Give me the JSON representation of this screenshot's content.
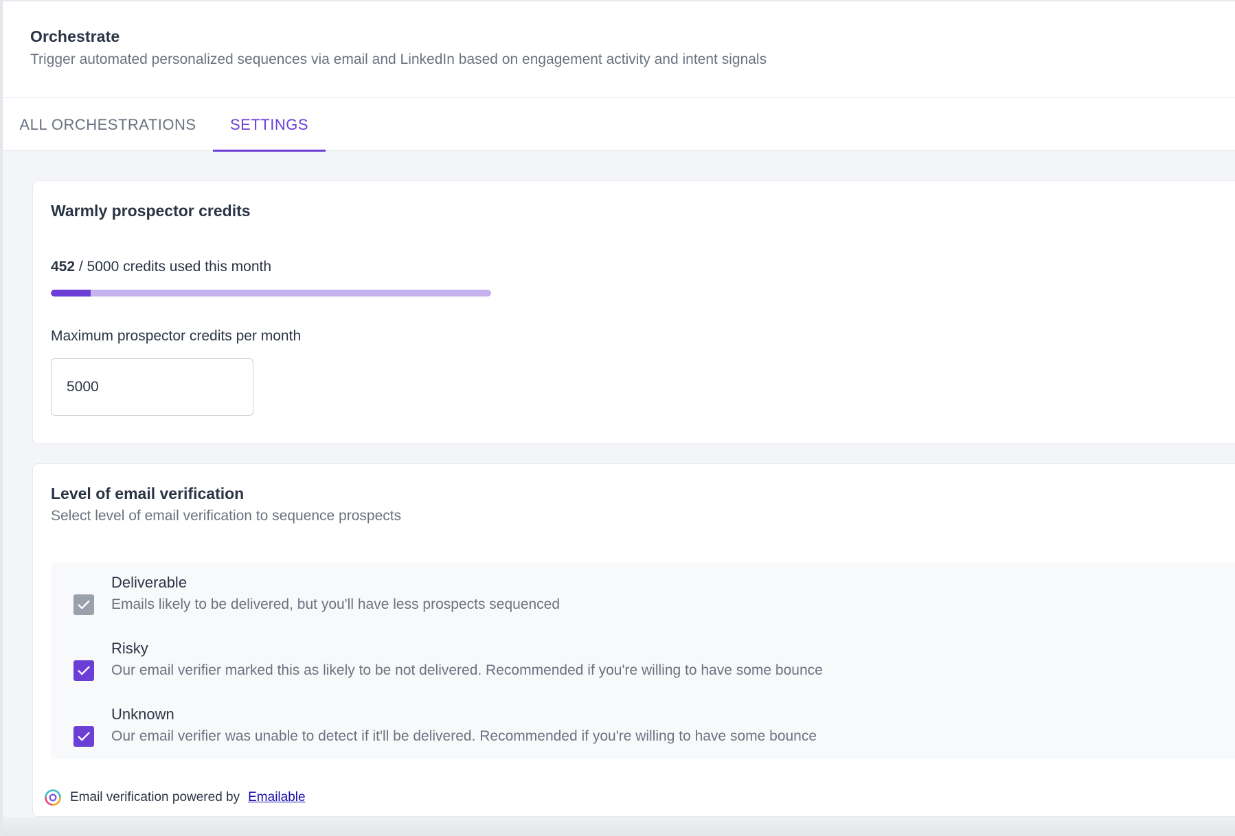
{
  "header": {
    "title": "Orchestrate",
    "subtitle": "Trigger automated personalized sequences via email and LinkedIn based on engagement activity and intent signals"
  },
  "tabs": [
    {
      "label": "ALL ORCHESTRATIONS",
      "active": false
    },
    {
      "label": "SETTINGS",
      "active": true
    }
  ],
  "credits": {
    "title": "Warmly prospector credits",
    "used": "452",
    "usage_text": " / 5000 credits used this month",
    "total": 5000,
    "used_fraction": 0.0904,
    "max_label": "Maximum prospector credits per month",
    "max_value": "5000"
  },
  "verification": {
    "title": "Level of email verification",
    "subtitle": "Select level of email verification to sequence prospects",
    "options": [
      {
        "label": "Deliverable",
        "description": "Emails likely to be delivered, but you'll have less prospects sequenced",
        "checked": true,
        "disabled": true
      },
      {
        "label": "Risky",
        "description": "Our email verifier marked this as likely to be not delivered. Recommended if you're willing to have some bounce",
        "checked": true,
        "disabled": false
      },
      {
        "label": "Unknown",
        "description": "Our email verifier was unable to detect if it'll be delivered. Recommended if you're willing to have some bounce",
        "checked": true,
        "disabled": false
      }
    ],
    "powered_by_text": "Email verification powered by",
    "powered_by_link": "Emailable"
  },
  "colors": {
    "accent": "#6b3fd6",
    "accent_light": "#c6b2ee",
    "disabled_check": "#9aa1ad",
    "text_primary": "#2b3445",
    "text_secondary": "#6b7280"
  },
  "icons": {
    "checkbox_check": "check-icon",
    "powered_logo": "emailable-logo-icon"
  }
}
